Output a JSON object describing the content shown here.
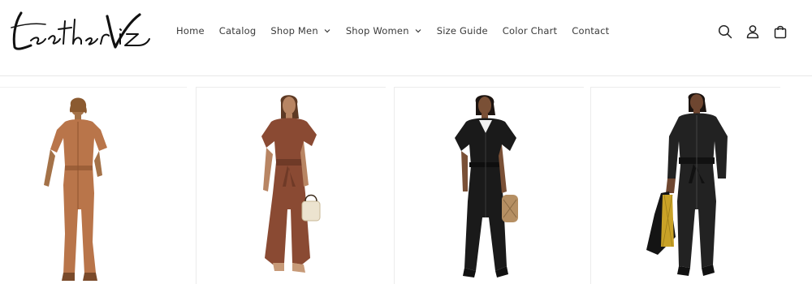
{
  "brand": {
    "logo_text": "LeatherViz"
  },
  "nav": {
    "items": [
      {
        "label": "Home",
        "has_dropdown": false
      },
      {
        "label": "Catalog",
        "has_dropdown": false
      },
      {
        "label": "Shop Men",
        "has_dropdown": true
      },
      {
        "label": "Shop Women",
        "has_dropdown": true
      },
      {
        "label": "Size Guide",
        "has_dropdown": false
      },
      {
        "label": "Color Chart",
        "has_dropdown": false
      },
      {
        "label": "Contact",
        "has_dropdown": false
      }
    ]
  },
  "header_icons": [
    "search-icon",
    "account-icon",
    "cart-icon"
  ],
  "products": [
    {
      "image": "tan-leather-jumpsuit-image",
      "color": "#b9754a"
    },
    {
      "image": "rust-leather-belted-jumpsuit-image",
      "color": "#8a4a33"
    },
    {
      "image": "black-leather-jumpsuit-image",
      "color": "#1a1a1a"
    },
    {
      "image": "black-leather-utility-jumpsuit-image",
      "color": "#222222"
    }
  ]
}
